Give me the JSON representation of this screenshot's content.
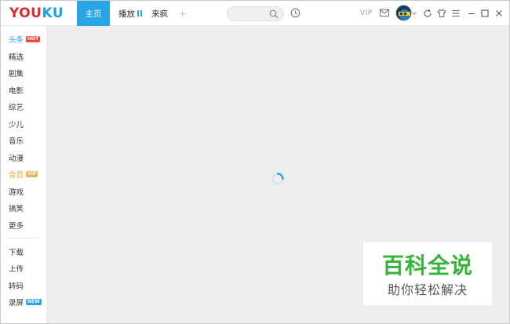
{
  "header": {
    "logo_you": "YOU",
    "logo_ku": "KU",
    "nav": {
      "home": "主页",
      "play": "播放",
      "laifeng": "来疯",
      "add": "+"
    },
    "search": {
      "placeholder": ""
    },
    "vip": "VIP"
  },
  "sidebar": {
    "items": [
      {
        "label": "头条",
        "badge": "HOT"
      },
      {
        "label": "精选"
      },
      {
        "label": "剧集"
      },
      {
        "label": "电影"
      },
      {
        "label": "综艺"
      },
      {
        "label": "少儿"
      },
      {
        "label": "音乐"
      },
      {
        "label": "动漫"
      },
      {
        "label": "会员",
        "badge": "VIP"
      },
      {
        "label": "游戏"
      },
      {
        "label": "搞笑"
      },
      {
        "label": "更多"
      }
    ],
    "tools": [
      {
        "label": "下载"
      },
      {
        "label": "上传"
      },
      {
        "label": "转码"
      },
      {
        "label": "录屏",
        "badge": "NEW"
      }
    ]
  },
  "watermark": {
    "title": "百科全说",
    "subtitle": "助你轻松解决"
  },
  "colors": {
    "accent": "#27a6e5",
    "logo_red": "#e0282e",
    "vip_gold": "#e0a82e",
    "watermark_green": "#35b43a"
  }
}
